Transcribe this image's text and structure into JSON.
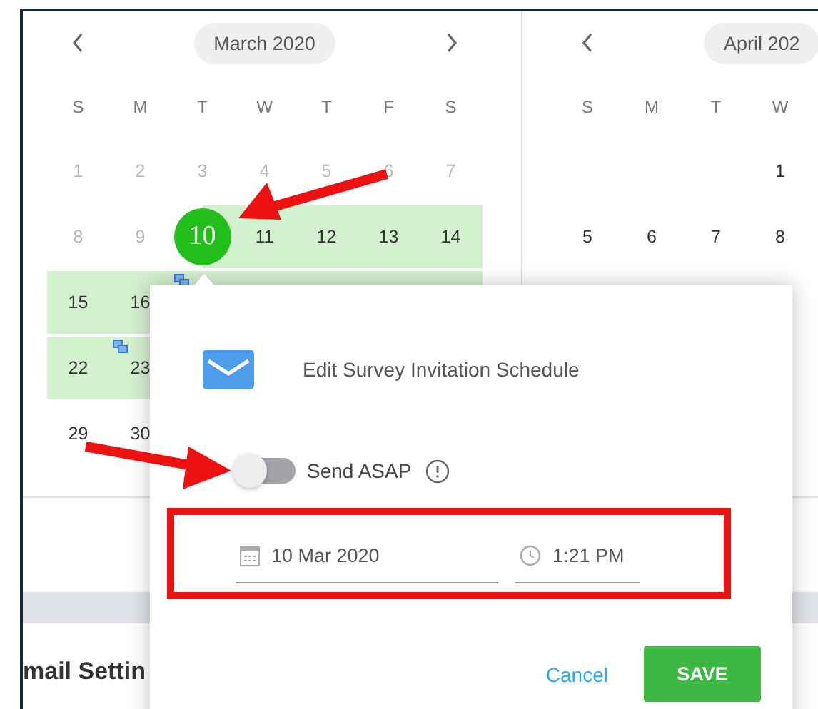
{
  "calendars": [
    {
      "title": "March 2020",
      "has_next": true,
      "weekdays": [
        "S",
        "M",
        "T",
        "W",
        "T",
        "F",
        "S"
      ],
      "weeks": [
        [
          {
            "kind": "day",
            "label": "1",
            "muted": true
          },
          {
            "kind": "day",
            "label": "2",
            "muted": true
          },
          {
            "kind": "day",
            "label": "3",
            "muted": true
          },
          {
            "kind": "day",
            "label": "4",
            "muted": true
          },
          {
            "kind": "day",
            "label": "5",
            "muted": true
          },
          {
            "kind": "day",
            "label": "6",
            "muted": true
          },
          {
            "kind": "day",
            "label": "7",
            "muted": true
          }
        ],
        [
          {
            "kind": "day",
            "label": "8",
            "muted": true
          },
          {
            "kind": "day",
            "label": "9",
            "muted": true
          },
          {
            "kind": "day",
            "label": "10",
            "selected": true,
            "in_range": true
          },
          {
            "kind": "day",
            "label": "11",
            "in_range": true
          },
          {
            "kind": "day",
            "label": "12",
            "in_range": true
          },
          {
            "kind": "day",
            "label": "13",
            "in_range": true
          },
          {
            "kind": "day",
            "label": "14",
            "in_range": true
          }
        ],
        [
          {
            "kind": "day",
            "label": "15",
            "in_range": true
          },
          {
            "kind": "day",
            "label": "16",
            "in_range": true
          },
          {
            "kind": "blank",
            "in_range": true,
            "event": true
          },
          {
            "kind": "blank",
            "in_range": true
          },
          {
            "kind": "blank",
            "in_range": true
          },
          {
            "kind": "blank",
            "in_range": true
          },
          {
            "kind": "blank",
            "in_range": true
          }
        ],
        [
          {
            "kind": "day",
            "label": "22",
            "in_range": true
          },
          {
            "kind": "day",
            "label": "23",
            "in_range": true,
            "event": true
          }
        ],
        [
          {
            "kind": "day",
            "label": "29"
          },
          {
            "kind": "day",
            "label": "30"
          }
        ]
      ]
    },
    {
      "title": "April 202",
      "weekdays": [
        "S",
        "M",
        "T",
        "W"
      ],
      "weeks": [
        [
          {
            "kind": "blank"
          },
          {
            "kind": "blank"
          },
          {
            "kind": "blank"
          },
          {
            "kind": "day",
            "label": "1"
          }
        ],
        [
          {
            "kind": "day",
            "label": "5"
          },
          {
            "kind": "day",
            "label": "6"
          },
          {
            "kind": "day",
            "label": "7"
          },
          {
            "kind": "day",
            "label": "8"
          }
        ]
      ]
    }
  ],
  "section_heading": "mail Settin",
  "dialog": {
    "title": "Edit Survey Invitation Schedule",
    "send_asap": {
      "label": "Send ASAP",
      "on": false
    },
    "date": {
      "value": "10 Mar 2020"
    },
    "time": {
      "value": "1:21 PM"
    },
    "cancel": "Cancel",
    "save": "SAVE"
  }
}
